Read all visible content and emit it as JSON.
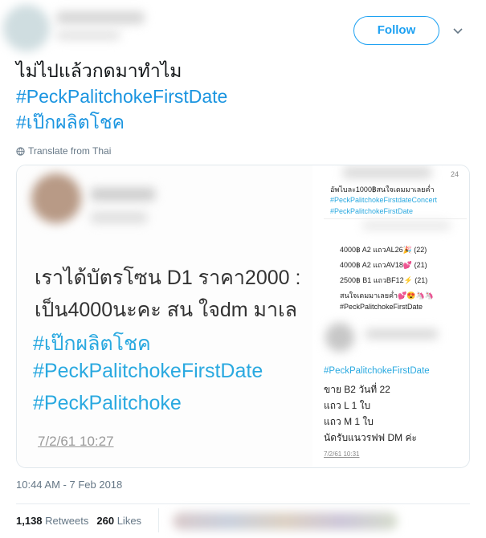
{
  "header": {
    "follow_label": "Follow"
  },
  "tweet": {
    "line1": "ไม่ไปแล้วกดมาทำไม",
    "hashtag1": "#PeckPalitchokeFirstDate",
    "hashtag2": "#เป๊กผลิตโชค",
    "translate_label": "Translate from Thai"
  },
  "left_image": {
    "line1": "เราได้บัตรโซน D1 ราคา2000 :",
    "line2": "เป็น4000นะคะ สน ใจdm มาเล",
    "hash1": "#เป๊กผลิตโชค",
    "hash2": "#PeckPalitchokeFirstDate",
    "hash3": "#PeckPalitchoke",
    "date": "7/2/61 10:27"
  },
  "right_image_top": {
    "time": "24",
    "line1": "อัพไบละ1000฿สนใจเดมมาเลยค่ำ",
    "hash1": "#PeckPalitchokeFirstdateConcert",
    "hash2": "#PeckPalitchokeFirstDate"
  },
  "right_image_mid": {
    "row1": "4000฿ A2 แถวAL26🎉 (22)",
    "row2": "4000฿ A2 แถวAV18💕 (21)",
    "row3": "2500฿ B1 แถวBF12⚡ (21)",
    "row4": "สนใจเดมมาเลยค่ำ💕😍🦄🦄",
    "hash": "#PeckPalitchokeFirstDate"
  },
  "right_image_bottom": {
    "hash": "#PeckPalitchokeFirstDate",
    "line1": "ขาย B2 วันที่ 22",
    "line2": "แถว L 1 ใบ",
    "line3": "แถว M 1 ใบ",
    "line4": "นัดรับแนวรฟฟ DM ค่ะ",
    "date": "7/2/61 10:31"
  },
  "meta": {
    "timestamp": "10:44 AM - 7 Feb 2018",
    "retweets_count": "1,138",
    "retweets_label": "Retweets",
    "likes_count": "260",
    "likes_label": "Likes"
  },
  "colors": {
    "accent": "#1da1f2",
    "hashtag": "#1b95e0"
  }
}
